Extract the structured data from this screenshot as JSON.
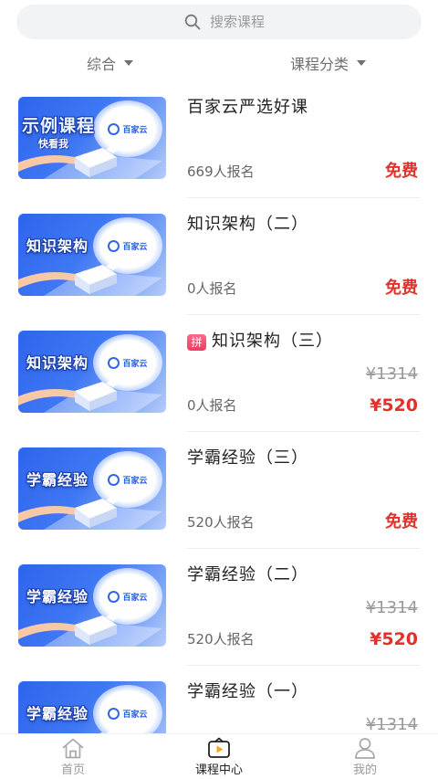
{
  "search": {
    "placeholder": "搜索课程",
    "icon": "search-icon"
  },
  "filters": [
    {
      "label": "综合",
      "icon": "caret-down-icon"
    },
    {
      "label": "课程分类",
      "icon": "caret-down-icon"
    }
  ],
  "brand_logo_text": "百家云",
  "courses": [
    {
      "thumb_title": "示例课程",
      "thumb_subtitle": "快看我",
      "title": "百家云严选好课",
      "enrolled": "669人报名",
      "price": "免费"
    },
    {
      "thumb_title": "知识架构",
      "title": "知识架构（二）",
      "enrolled": "0人报名",
      "price": "免费"
    },
    {
      "thumb_title": "知识架构",
      "badge": "拼",
      "title": "知识架构（三）",
      "original_price": "¥1314",
      "enrolled": "0人报名",
      "price": "¥520"
    },
    {
      "thumb_title": "学霸经验",
      "title": "学霸经验（三）",
      "enrolled": "520人报名",
      "price": "免费"
    },
    {
      "thumb_title": "学霸经验",
      "title": "学霸经验（二）",
      "original_price": "¥1314",
      "enrolled": "520人报名",
      "price": "¥520"
    },
    {
      "thumb_title": "学霸经验",
      "title": "学霸经验（一）",
      "original_price": "¥1314"
    }
  ],
  "tabbar": [
    {
      "label": "首页",
      "icon": "home-icon",
      "active": false
    },
    {
      "label": "课程中心",
      "icon": "course-center-icon",
      "active": true
    },
    {
      "label": "我的",
      "icon": "user-icon",
      "active": false
    }
  ],
  "colors": {
    "price_red": "#e4302b",
    "badge_pink": "#f03a64",
    "thumbnail_blue": "#2e64ee",
    "search_bg": "#f2f3f5"
  }
}
